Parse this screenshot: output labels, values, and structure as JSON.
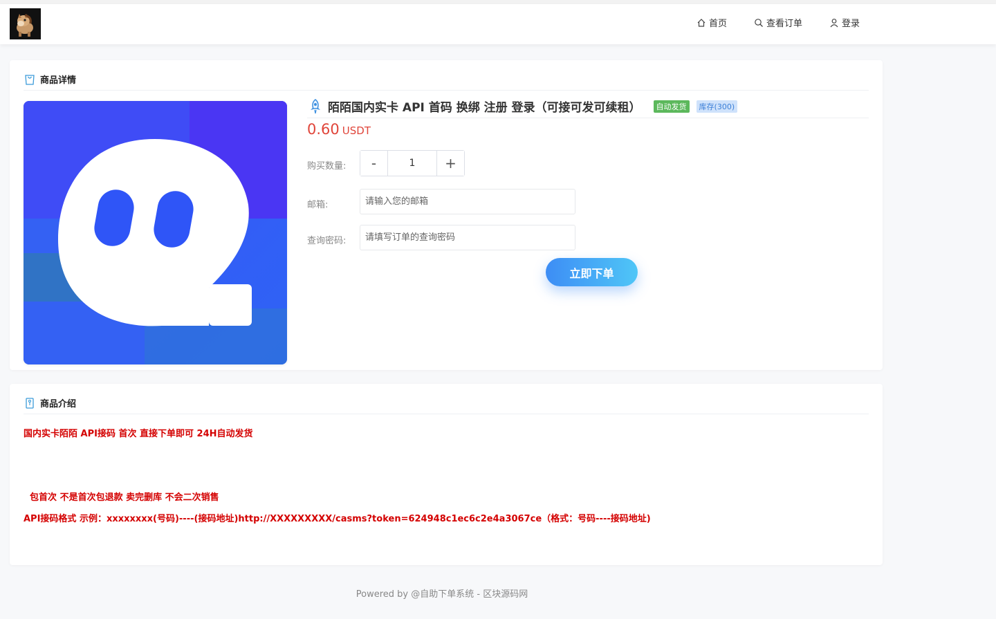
{
  "nav": {
    "home": "首页",
    "orders": "查看订单",
    "login": "登录"
  },
  "detail": {
    "header": "商品详情",
    "title": "陌陌国内实卡 API 首码 换绑 注册 登录（可接可发可续租）",
    "badge_auto": "自动发货",
    "badge_stock": "库存(300)",
    "price": "0.60",
    "currency": "USDT",
    "qty_label": "购买数量:",
    "qty_minus": "-",
    "qty_value": "1",
    "qty_plus": "+",
    "email_label": "邮箱:",
    "email_placeholder": "请输入您的邮箱",
    "password_label": "查询密码:",
    "password_placeholder": "请填写订单的查询密码",
    "order_button": "立即下单"
  },
  "intro": {
    "header": "商品介绍",
    "line1": "国内实卡陌陌 API接码 首次   直接下单即可 24H自动发货",
    "line2": "  包首次 不是首次包退款 卖完删库 不会二次销售",
    "line3": "API接码格式 示例：xxxxxxxx(号码)----(接码地址)http://XXXXXXXXX/casms?token=624948c1ec6c2e4a3067ce（格式：号码----接码地址)"
  },
  "footer": "Powered by @自助下单系统 - 区块源码网",
  "colors": {
    "price": "#e0453a",
    "desc_text": "#d40000",
    "badge_green": "#5cb85c",
    "badge_blue_bg": "#cfe2fb",
    "button_start": "#3d8df5",
    "button_end": "#4fc6f7"
  }
}
